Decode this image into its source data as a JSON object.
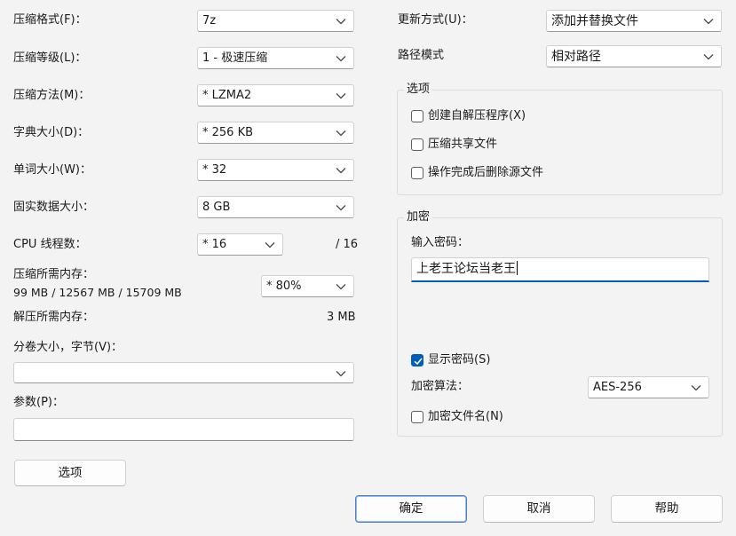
{
  "left": {
    "compress_format": {
      "label": "压缩格式(F)：",
      "value": "7z"
    },
    "compress_level": {
      "label": "压缩等级(L)：",
      "value": "1 - 极速压缩"
    },
    "compress_method": {
      "label": "压缩方法(M)：",
      "value": "* LZMA2"
    },
    "dictionary_size": {
      "label": "字典大小(D)：",
      "value": "* 256 KB"
    },
    "word_size": {
      "label": "单词大小(W)：",
      "value": "* 32"
    },
    "solid_block_size": {
      "label": "固实数据大小：",
      "value": "8 GB"
    },
    "cpu_threads": {
      "label": "CPU 线程数：",
      "value": "* 16",
      "max": "/ 16"
    },
    "memory_compress": {
      "label": "压缩所需内存：",
      "detail": "99 MB / 12567 MB / 15709 MB",
      "value": "* 80%"
    },
    "memory_decompress": {
      "label": "解压所需内存：",
      "value": "3 MB"
    },
    "split_volume": {
      "label": "分卷大小，字节(V)：",
      "value": ""
    },
    "parameters": {
      "label": "参数(P)：",
      "value": ""
    },
    "options_button": "选项"
  },
  "right": {
    "update_mode": {
      "label": "更新方式(U)：",
      "value": "添加并替换文件"
    },
    "path_mode": {
      "label": "路径模式",
      "value": "相对路径"
    },
    "options_group": {
      "title": "选项",
      "items": [
        {
          "label": "创建自解压程序(X)",
          "checked": false
        },
        {
          "label": "压缩共享文件",
          "checked": false
        },
        {
          "label": "操作完成后删除源文件",
          "checked": false
        }
      ]
    },
    "encryption_group": {
      "title": "加密",
      "password_label": "输入密码：",
      "password_value": "上老王论坛当老王",
      "show_password": {
        "label": "显示密码(S)",
        "checked": true
      },
      "method_label": "加密算法：",
      "method_value": "AES-256",
      "encrypt_names": {
        "label": "加密文件名(N)",
        "checked": false
      }
    }
  },
  "footer": {
    "ok": "确定",
    "cancel": "取消",
    "help": "帮助"
  }
}
